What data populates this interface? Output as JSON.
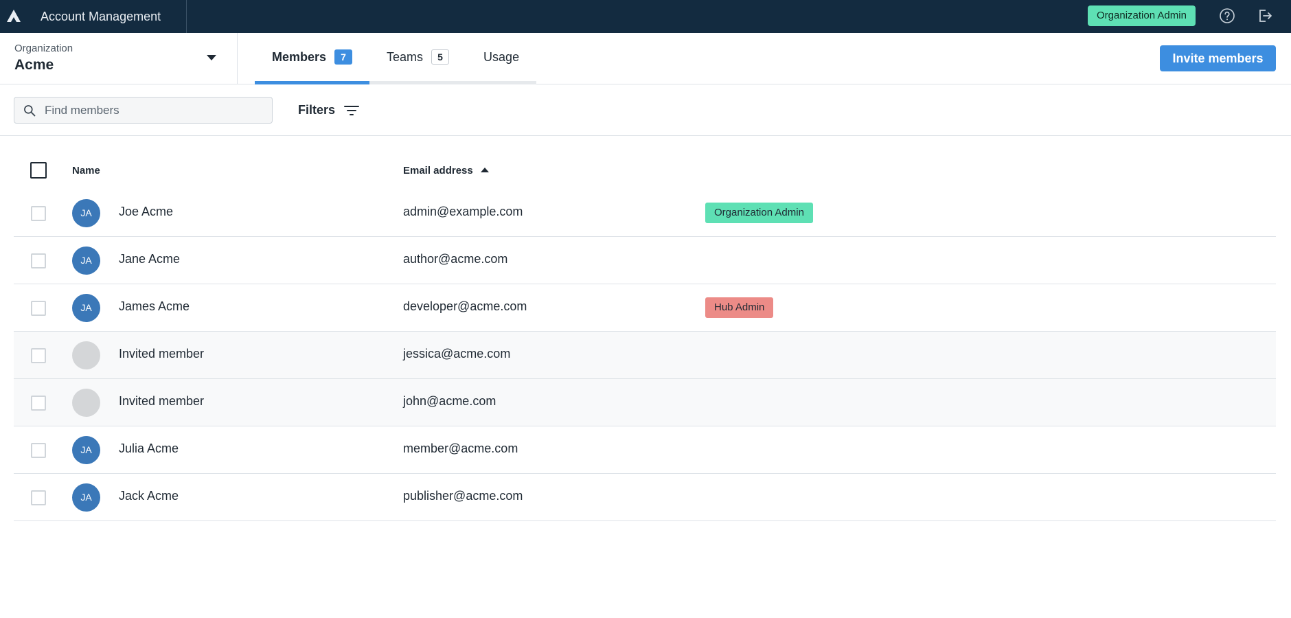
{
  "header": {
    "app_title": "Account Management",
    "role_badge": "Organization Admin",
    "role_badge_color": "#5ee0b4",
    "background_color": "#132b40",
    "icons": [
      "logo-icon",
      "help-icon",
      "logout-icon"
    ]
  },
  "org_selector": {
    "label": "Organization",
    "value": "Acme"
  },
  "tabs": [
    {
      "label": "Members",
      "count": "7",
      "active": true
    },
    {
      "label": "Teams",
      "count": "5",
      "active": false
    },
    {
      "label": "Usage",
      "count": "",
      "active": false
    }
  ],
  "invite_button": {
    "label": "Invite members",
    "color": "#3d8ee0"
  },
  "toolbar": {
    "search_placeholder": "Find members",
    "filters_label": "Filters"
  },
  "table": {
    "columns": {
      "name": "Name",
      "email": "Email address",
      "email_sort": "ascending"
    },
    "rows": [
      {
        "initials": "JA",
        "name": "Joe Acme",
        "email": "admin@example.com",
        "role": "Organization Admin",
        "role_color": "#5ee0b4",
        "invited": false
      },
      {
        "initials": "JA",
        "name": "Jane Acme",
        "email": "author@acme.com",
        "role": "",
        "role_color": "",
        "invited": false
      },
      {
        "initials": "JA",
        "name": "James Acme",
        "email": "developer@acme.com",
        "role": "Hub Admin",
        "role_color": "#ec8b87",
        "invited": false
      },
      {
        "initials": "",
        "name": "Invited member",
        "email": "jessica@acme.com",
        "role": "",
        "role_color": "",
        "invited": true
      },
      {
        "initials": "",
        "name": "Invited member",
        "email": "john@acme.com",
        "role": "",
        "role_color": "",
        "invited": true
      },
      {
        "initials": "JA",
        "name": "Julia Acme",
        "email": "member@acme.com",
        "role": "",
        "role_color": "",
        "invited": false
      },
      {
        "initials": "JA",
        "name": "Jack Acme",
        "email": "publisher@acme.com",
        "role": "",
        "role_color": "",
        "invited": false
      }
    ]
  }
}
